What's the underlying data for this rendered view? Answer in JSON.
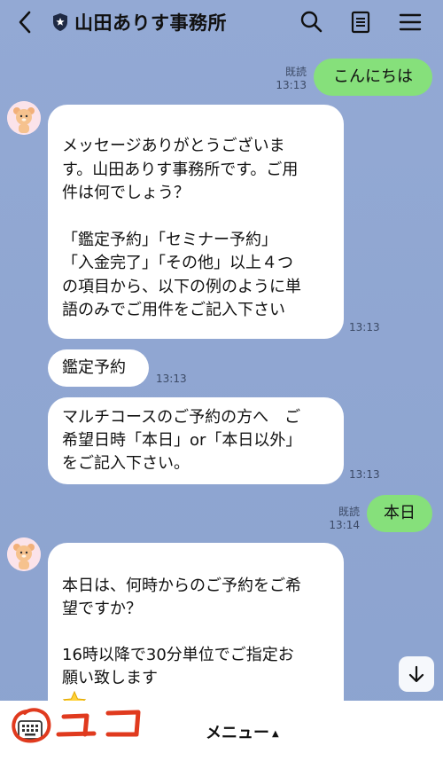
{
  "header": {
    "title": "山田ありす事務所",
    "back_icon": "chevron-left-icon",
    "account_icon": "shield-star-icon",
    "search_icon": "search-icon",
    "notes_icon": "notes-icon",
    "menu_icon": "hamburger-icon"
  },
  "messages": [
    {
      "side": "right",
      "text": "こんにちは",
      "read": "既読",
      "time": "13:13"
    },
    {
      "side": "left",
      "text": "メッセージありがとうございま\nす。山田ありす事務所です。ご用\n件は何でしょう？\n\n「鑑定予約」「セミナー予約」\n「入金完了」「その他」以上４つ\nの項目から、以下の例のように単\n語のみでご用件をご記入下さい",
      "time": "13:13"
    },
    {
      "side": "left",
      "text": "鑑定予約",
      "time": "13:13"
    },
    {
      "side": "left",
      "text": "マルチコースのご予約の方へ　ご\n希望日時「本日」or「本日以外」\nをご記入下さい。",
      "time": "13:13"
    },
    {
      "side": "right",
      "text": "本日",
      "read": "既読",
      "time": "13:14"
    },
    {
      "side": "left",
      "text": "本日は、何時からのご予約をご希\n望ですか？\n\n16時以降で30分単位でご指定お\n願い致します"
    }
  ],
  "bottom": {
    "menu_label": "メニュー",
    "menu_arrow": "▲",
    "annotation": "ユコ",
    "keyboard_icon": "keyboard-icon"
  },
  "colors": {
    "background": "#8ea4cf",
    "bubble_in": "#ffffff",
    "bubble_out": "#86e07b",
    "annotation": "#e03a1e"
  }
}
